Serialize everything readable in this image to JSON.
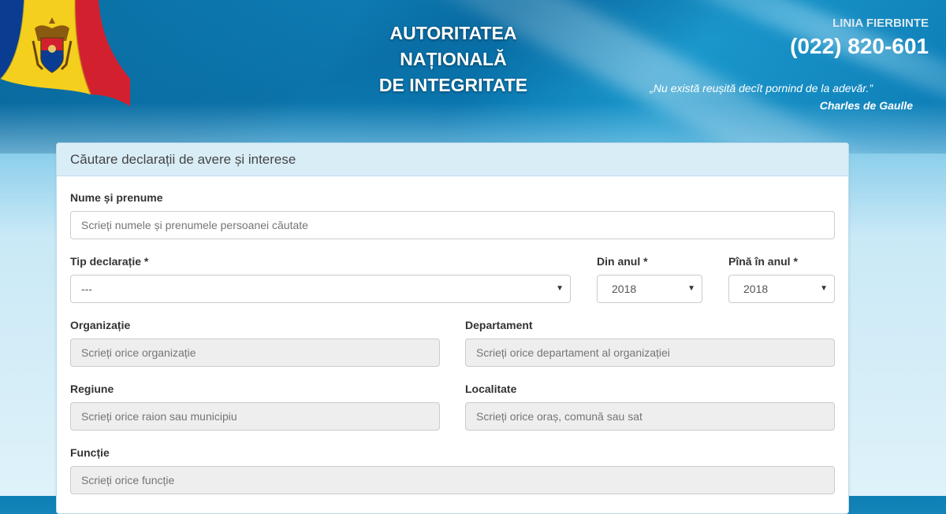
{
  "header": {
    "org_title_line1": "AUTORITATEA",
    "org_title_line2": "NAȚIONALĂ",
    "org_title_line3": "DE INTEGRITATE",
    "hotline_label": "LINIA FIERBINTE",
    "hotline_number": "(022) 820-601",
    "quote": "„Nu există reușită decît pornind de la adevăr.”",
    "quote_author": "Charles de Gaulle"
  },
  "panel": {
    "title": "Căutare declarații de avere și interese"
  },
  "form": {
    "name": {
      "label": "Nume și prenume",
      "placeholder": "Scrieți numele și prenumele persoanei căutate"
    },
    "declaration_type": {
      "label": "Tip declarație *",
      "value": "---"
    },
    "year_from": {
      "label": "Din anul *",
      "value": "2018"
    },
    "year_to": {
      "label": "Pînă în anul *",
      "value": "2018"
    },
    "organization": {
      "label": "Organizație",
      "placeholder": "Scrieți orice organizație"
    },
    "department": {
      "label": "Departament",
      "placeholder": "Scrieți orice departament al organizației"
    },
    "region": {
      "label": "Regiune",
      "placeholder": "Scrieți orice raion sau municipiu"
    },
    "locality": {
      "label": "Localitate",
      "placeholder": "Scrieți orice oraș, comună sau sat"
    },
    "function": {
      "label": "Funcție",
      "placeholder": "Scrieți orice funcție"
    }
  },
  "icons": {
    "flag": "moldova-flag-icon",
    "dropdown": "caret-down-icon"
  },
  "colors": {
    "panel_header": "#d9edf7",
    "hero_blue": "#0f86be",
    "disabled_input": "#eeeeee"
  }
}
